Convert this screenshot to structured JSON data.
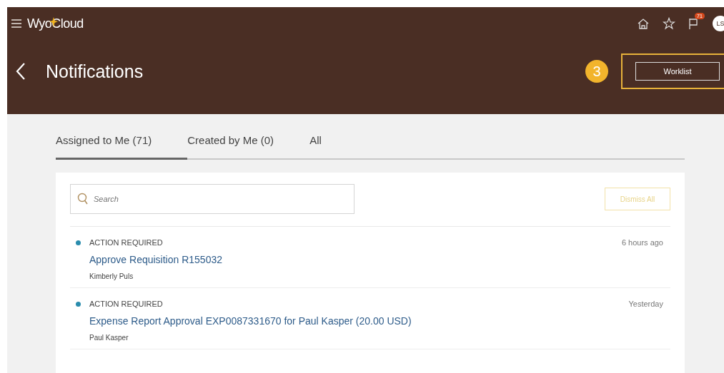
{
  "app_bar": {
    "logo": "WyoCloud",
    "notification_count": "71",
    "avatar": "LS"
  },
  "page_header": {
    "title": "Notifications",
    "step_marker": "3",
    "worklist_button": "Worklist"
  },
  "tabs": [
    {
      "label": "Assigned to Me (71)",
      "selected": true
    },
    {
      "label": "Created by Me (0)",
      "selected": false
    },
    {
      "label": "All",
      "selected": false
    }
  ],
  "search": {
    "placeholder": "Search"
  },
  "dismiss_button": {
    "label": "Dismiss All",
    "disabled": true
  },
  "notifications": [
    {
      "status": "ACTION REQUIRED",
      "title": "Approve Requisition R155032",
      "from": "Kimberly Puls",
      "time": "6 hours ago",
      "unread": true
    },
    {
      "status": "ACTION REQUIRED",
      "title": "Expense Report Approval EXP0087331670 for Paul Kasper (20.00 USD)",
      "from": "Paul Kasper",
      "time": "Yesterday",
      "unread": true
    }
  ]
}
